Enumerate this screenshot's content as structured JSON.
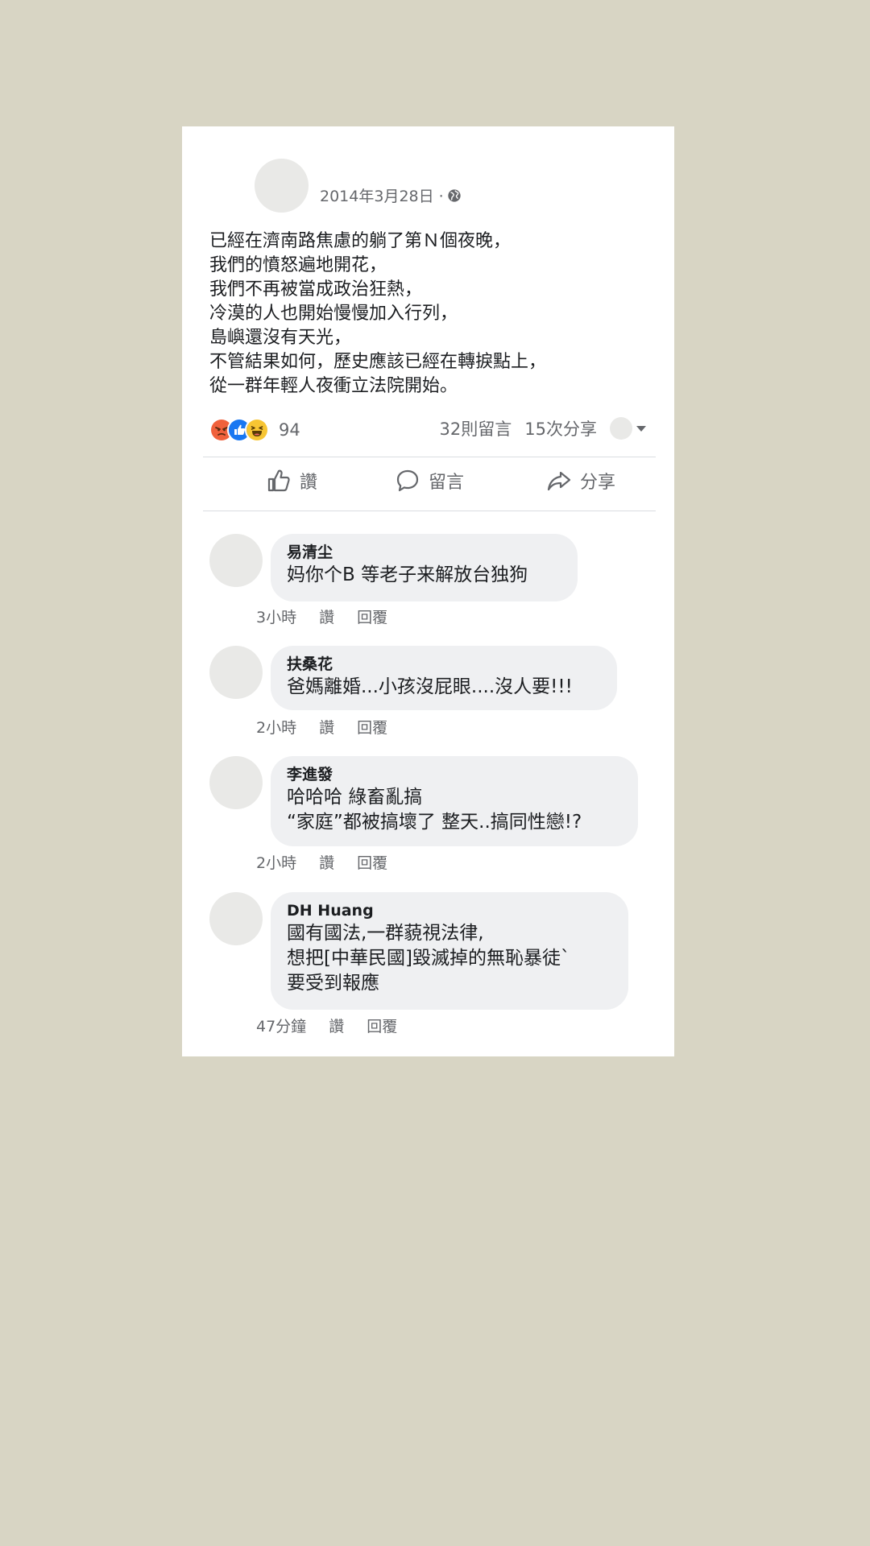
{
  "post": {
    "date": "2014年3月28日 ·",
    "lines": [
      "已經在濟南路焦慮的躺了第Ｎ個夜晚，",
      "我們的憤怒遍地開花，",
      "我們不再被當成政治狂熱，",
      "冷漠的人也開始慢慢加入行列，",
      "島嶼還沒有天光，",
      "不管結果如何，歷史應該已經在轉捩點上，",
      "從一群年輕人夜衝立法院開始。"
    ],
    "reaction_count": "94",
    "comments_count": "32則留言",
    "shares_count": "15次分享"
  },
  "actions": {
    "like": "讚",
    "comment": "留言",
    "share": "分享"
  },
  "comments": [
    {
      "name": "易清尘",
      "lines": [
        "妈你个B 等老子来解放台独狗"
      ],
      "time": "3小時",
      "like": "讚",
      "reply": "回覆"
    },
    {
      "name": "扶桑花",
      "lines": [
        "爸媽離婚...小孩沒屁眼....沒人要!!!"
      ],
      "time": "2小時",
      "like": "讚",
      "reply": "回覆"
    },
    {
      "name": "李進發",
      "lines": [
        "哈哈哈 綠畜亂搞",
        "“家庭”都被搞壞了 整天..搞同性戀!?"
      ],
      "time": "2小時",
      "like": "讚",
      "reply": "回覆"
    },
    {
      "name": "DH Huang",
      "lines": [
        "國有國法,一群藐視法律,",
        "想把[中華民國]毀滅掉的無恥暴徒`",
        "要受到報應"
      ],
      "time": "47分鐘",
      "like": "讚",
      "reply": "回覆"
    }
  ],
  "colors": {
    "background": "#d8d5c4",
    "card": "#ffffff",
    "bubble": "#eff0f2",
    "angry": "#f0613c",
    "like": "#1877f2",
    "haha": "#f7c533",
    "secondary_text": "#65676b"
  },
  "icons": [
    "globe-icon",
    "angry-reaction-icon",
    "like-reaction-icon",
    "haha-reaction-icon",
    "caret-down-icon",
    "thumbs-up-icon",
    "speech-bubble-icon",
    "share-arrow-icon"
  ]
}
